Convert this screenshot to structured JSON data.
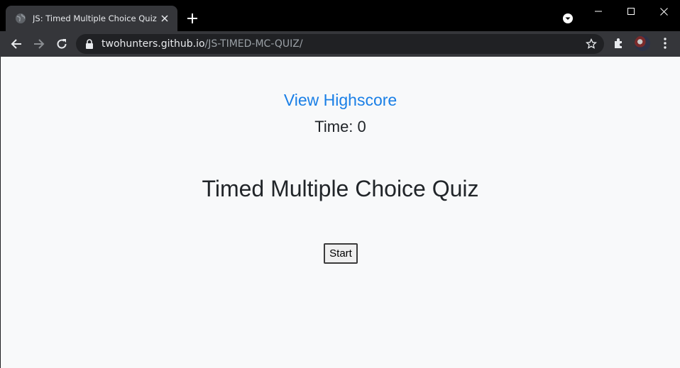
{
  "browser": {
    "tab": {
      "title": "JS: Timed Multiple Choice Quiz",
      "favicon": "globe-icon"
    },
    "address": {
      "host": "twohunters.github.io",
      "path": "/JS-TIMED-MC-QUIZ/"
    }
  },
  "page": {
    "highscore_link": "View Highscore",
    "timer_text": "Time: 0",
    "title": "Timed Multiple Choice Quiz",
    "start_button": "Start"
  },
  "colors": {
    "link": "#1a7fe6",
    "page_background": "#f8f9fa",
    "text": "#212529",
    "browser_frame": "#000000",
    "toolbar": "#35363a"
  }
}
